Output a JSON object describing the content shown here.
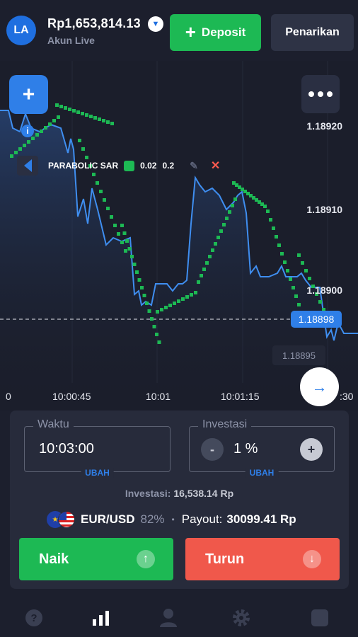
{
  "header": {
    "avatar_initials": "LA",
    "balance": "Rp1,653,814.13",
    "account_type": "Akun Live",
    "deposit_label": "Deposit",
    "withdraw_label": "Penarikan"
  },
  "chart": {
    "price_ticks": [
      "1.18920",
      "1.18910",
      "1.18900"
    ],
    "time_ticks": [
      "0",
      "10:00:45",
      "10:01",
      "10:01:15",
      ":30"
    ],
    "current_price": "1.18898",
    "hover_price": "1.18895",
    "indicator": {
      "name": "PARABOLIC SAR",
      "param1": "0.02",
      "param2": "0.2"
    },
    "colors": {
      "line": "#3f8ef0",
      "sar": "#1db954",
      "accent": "#2f7fe8"
    }
  },
  "trade": {
    "time_label": "Waktu",
    "time_value": "10:03:00",
    "time_action": "UBAH",
    "invest_label": "Investasi",
    "invest_value": "1 %",
    "invest_action": "UBAH",
    "invest_minus": "-",
    "invest_plus": "+",
    "invest_summary_label": "Investasi:",
    "invest_summary_value": "16,538.14 Rp",
    "asset": "EUR/USD",
    "asset_pct": "82%",
    "payout_label": "Payout:",
    "payout_value": "30099.41 Rp",
    "up_label": "Naik",
    "down_label": "Turun"
  },
  "nav": {
    "items": [
      "help-icon",
      "chart-icon",
      "profile-icon",
      "settings-icon",
      "menu-icon"
    ]
  }
}
